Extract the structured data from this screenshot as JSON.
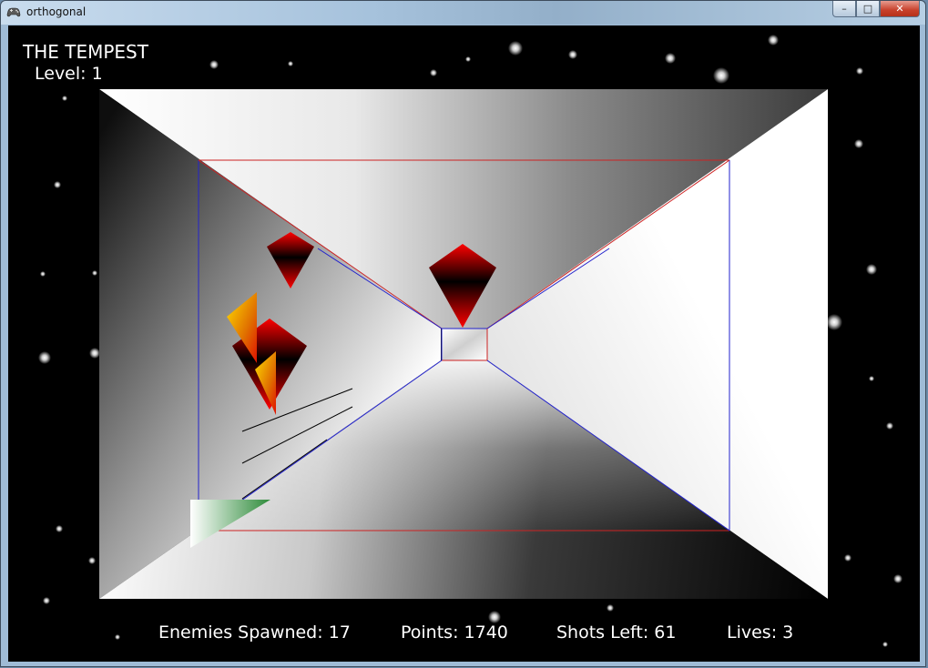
{
  "window": {
    "title": "orthogonal",
    "buttons": {
      "minimize": "–",
      "maximize": "□",
      "close": "✕"
    }
  },
  "hud": {
    "game_title": "THE TEMPEST",
    "level_label": "Level: 1",
    "enemies_spawned": "Enemies Spawned: 17",
    "points": "Points: 1740",
    "shots_left": "Shots Left: 61",
    "lives": "Lives: 3"
  },
  "colors": {
    "background": "#000000",
    "tunnel_edge_blue": "#2222cc",
    "tunnel_edge_red": "#cc2222",
    "enemy_red": "#e00000",
    "enemy_dark": "#000000",
    "spike_yellow": "#f0d000",
    "spike_orange": "#e04000",
    "player_green": "#2e8b3a"
  },
  "icons": {
    "app": "game-controller-icon"
  }
}
